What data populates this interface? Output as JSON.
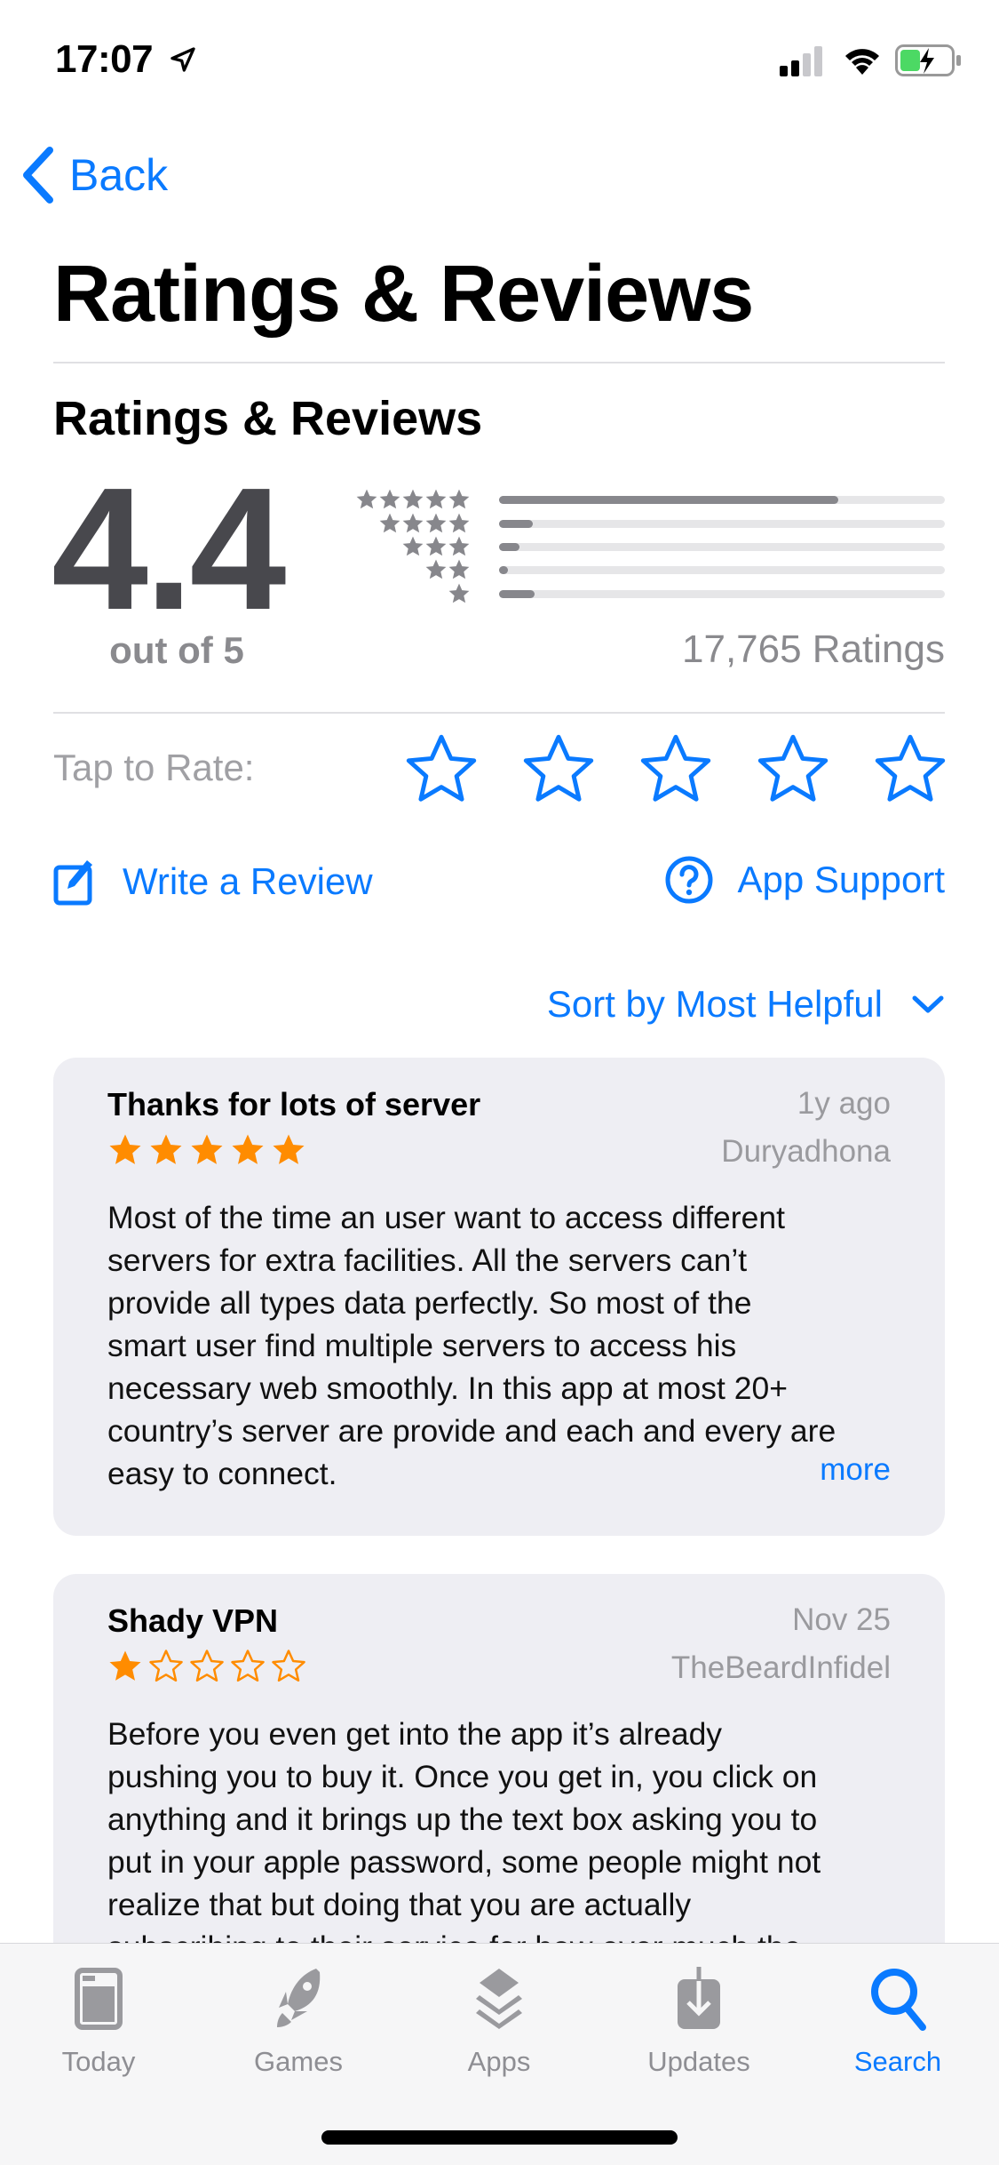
{
  "status_bar": {
    "time": "17:07",
    "icons": [
      "location-arrow-icon",
      "cellular-signal-icon",
      "wifi-icon",
      "battery-charging-icon"
    ]
  },
  "nav": {
    "back_label": "Back"
  },
  "page_title": "Ratings & Reviews",
  "summary": {
    "section_title": "Ratings & Reviews",
    "average": "4.4",
    "out_of": "out of 5",
    "ratings_count": "17,765 Ratings",
    "distribution": [
      {
        "stars": 5,
        "fraction": 0.76
      },
      {
        "stars": 4,
        "fraction": 0.075
      },
      {
        "stars": 3,
        "fraction": 0.045
      },
      {
        "stars": 2,
        "fraction": 0.02
      },
      {
        "stars": 1,
        "fraction": 0.08
      }
    ]
  },
  "tap_to_rate": {
    "label": "Tap to Rate:",
    "stars": 5
  },
  "actions": {
    "write_review": "Write a Review",
    "app_support": "App Support"
  },
  "sort": {
    "label": "Sort by Most Helpful"
  },
  "reviews": [
    {
      "title": "Thanks for lots of server",
      "date": "1y ago",
      "author": "Duryadhona",
      "rating": 5,
      "lines": [
        "Most of the time an user want to access different",
        "servers for extra facilities. All the servers can’t",
        "provide all types data perfectly. So most of the",
        "smart user find multiple servers to access his",
        "necessary web smoothly. In this app at most 20+",
        "country’s server are provide and each and every are",
        "easy to connect."
      ],
      "more": "more"
    },
    {
      "title": "Shady VPN",
      "date": "Nov 25",
      "author": "TheBeardInfidel",
      "rating": 1,
      "lines": [
        "Before you even get into the app it’s already",
        "pushing you to buy it. Once you get in, you click on",
        "anything and it brings up the text box asking you to",
        "put in your apple password, some people might not",
        "realize that but doing that you are actually",
        "subscribing to their service for how ever much the"
      ]
    }
  ],
  "tabs": [
    {
      "label": "Today",
      "icon": "today-icon"
    },
    {
      "label": "Games",
      "icon": "rocket-icon"
    },
    {
      "label": "Apps",
      "icon": "layers-icon"
    },
    {
      "label": "Updates",
      "icon": "download-icon"
    },
    {
      "label": "Search",
      "icon": "search-icon",
      "active": true
    }
  ],
  "colors": {
    "accent": "#0a7aff",
    "star": "#ff8c00",
    "card": "#eeeef3"
  }
}
